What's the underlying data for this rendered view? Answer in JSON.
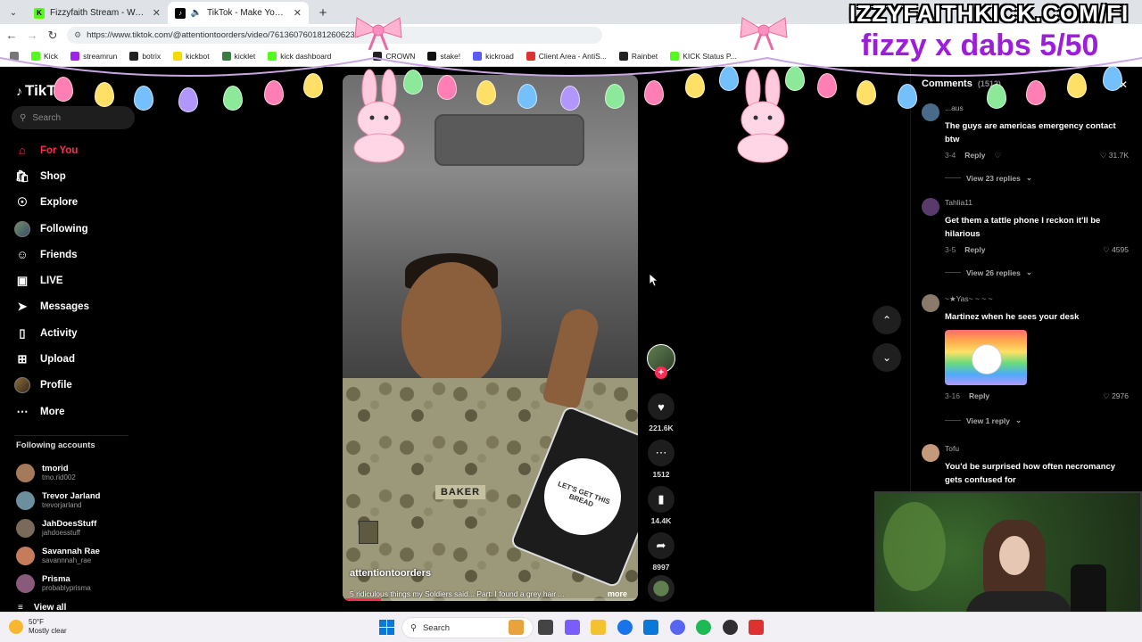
{
  "browser": {
    "tabs": [
      {
        "title": "Fizzyfaith Stream - Watch Live on Kick",
        "active": false,
        "favicon": "kick-icon",
        "color": "#53fc18"
      },
      {
        "title": "TikTok - Make Your Day",
        "active": true,
        "favicon": "tiktok-icon",
        "color": "#000000"
      }
    ],
    "url": "https://www.tiktok.com/@attentiontoorders/video/7613607601812606238",
    "bookmarks": [
      {
        "label": "Kick",
        "color": "#53fc18"
      },
      {
        "label": "streamrun",
        "color": "#a020f0"
      },
      {
        "label": "botrix",
        "color": "#222222"
      },
      {
        "label": "kickbot",
        "color": "#f5d90a"
      },
      {
        "label": "kicklet",
        "color": "#3a7d44"
      },
      {
        "label": "kick dashboard",
        "color": "#53fc18"
      },
      {
        "label": "CROWN",
        "color": "#222222"
      },
      {
        "label": "stake!",
        "color": "#111111"
      },
      {
        "label": "kickroad",
        "color": "#5a5aff"
      },
      {
        "label": "Client Area - AntiS...",
        "color": "#e03131"
      },
      {
        "label": "Rainbet",
        "color": "#222222"
      },
      {
        "label": "KICK Status P...",
        "color": "#53fc18"
      }
    ]
  },
  "tiktok": {
    "logo": "TikTok",
    "search_placeholder": "Search",
    "nav": [
      {
        "label": "For You",
        "icon": "home-icon",
        "active": true
      },
      {
        "label": "Shop",
        "icon": "shopping-bag-icon",
        "active": false
      },
      {
        "label": "Explore",
        "icon": "compass-icon",
        "active": false
      },
      {
        "label": "Following",
        "icon": "avatar-icon",
        "active": false
      },
      {
        "label": "Friends",
        "icon": "friends-icon",
        "active": false
      },
      {
        "label": "LIVE",
        "icon": "live-tv-icon",
        "active": false
      },
      {
        "label": "Messages",
        "icon": "send-icon",
        "active": false
      },
      {
        "label": "Activity",
        "icon": "inbox-icon",
        "active": false
      },
      {
        "label": "Upload",
        "icon": "upload-plus-icon",
        "active": false
      },
      {
        "label": "Profile",
        "icon": "avatar-icon",
        "active": false
      },
      {
        "label": "More",
        "icon": "more-dots-icon",
        "active": false
      }
    ],
    "following_title": "Following accounts",
    "following": [
      {
        "name": "tmorid",
        "handle": "tmo.rid002",
        "color": "#a57a5a"
      },
      {
        "name": "Trevor Jarland",
        "handle": "trevorjarland",
        "color": "#6b8f9c"
      },
      {
        "name": "JahDoesStuff",
        "handle": "jahdoesstuff",
        "color": "#7a6a5a"
      },
      {
        "name": "Savannah Rae",
        "handle": "savannnah_rae",
        "color": "#c47c5a"
      },
      {
        "name": "Prisma",
        "handle": "probablyprisma",
        "color": "#8a5a7a"
      }
    ],
    "view_all": "View all",
    "video": {
      "author": "attentiontoorders",
      "caption": "5 ridiculous things my Soldiers said... Part: I found a grey hair ...",
      "more": "more",
      "progress": 0.13,
      "sticker_text": "LET'S GET THIS BREAD",
      "name_tape": "BAKER"
    },
    "actions": {
      "likes": "221.6K",
      "comments": "1512",
      "saves": "14.4K",
      "shares": "8997"
    },
    "comments_panel": {
      "title": "Comments",
      "count": "(1512)",
      "items": [
        {
          "user": "...aus",
          "text": "The guys are americas emergency contact btw",
          "date": "3-4",
          "reply": "Reply",
          "likes": "31.7K",
          "view_replies": "View 23 replies",
          "avatar_color": "#4a6a8a"
        },
        {
          "user": "Tahlia11",
          "text": "Get them a tattle phone I reckon it'll be hilarious",
          "date": "3-5",
          "reply": "Reply",
          "likes": "4595",
          "view_replies": "View 26 replies",
          "avatar_color": "#5a3a6a"
        },
        {
          "user": "~★Yas~ ~ ~ ~",
          "text": "Martinez when he sees your desk",
          "date": "3-16",
          "reply": "Reply",
          "likes": "2976",
          "view_replies": "View 1 reply",
          "avatar_color": "#8a7a6a"
        },
        {
          "user": "Tofu",
          "text": "You'd be surprised how often necromancy gets confused for",
          "avatar_color": "#c49a7a"
        }
      ]
    }
  },
  "overlay": {
    "banner": "IZZYFAITHKICK.COM/FI",
    "subtitle": "fizzy x dabs 5/50"
  },
  "taskbar": {
    "weather_temp": "50°F",
    "weather_desc": "Mostly clear",
    "search_placeholder": "Search",
    "icons": [
      {
        "name": "pen-tool-icon",
        "color": "#e8a33d"
      },
      {
        "name": "task-view-icon",
        "color": "#444444"
      },
      {
        "name": "copilot-icon",
        "color": "#7b5cff"
      },
      {
        "name": "file-explorer-icon",
        "color": "#f2c230"
      },
      {
        "name": "chrome-icon",
        "color": "#1a73e8"
      },
      {
        "name": "store-icon",
        "color": "#0a78d7"
      },
      {
        "name": "discord-icon",
        "color": "#5865f2"
      },
      {
        "name": "spotify-icon",
        "color": "#1db954"
      },
      {
        "name": "obs-icon",
        "color": "#302e31"
      },
      {
        "name": "app-red-icon",
        "color": "#e03131"
      }
    ]
  }
}
